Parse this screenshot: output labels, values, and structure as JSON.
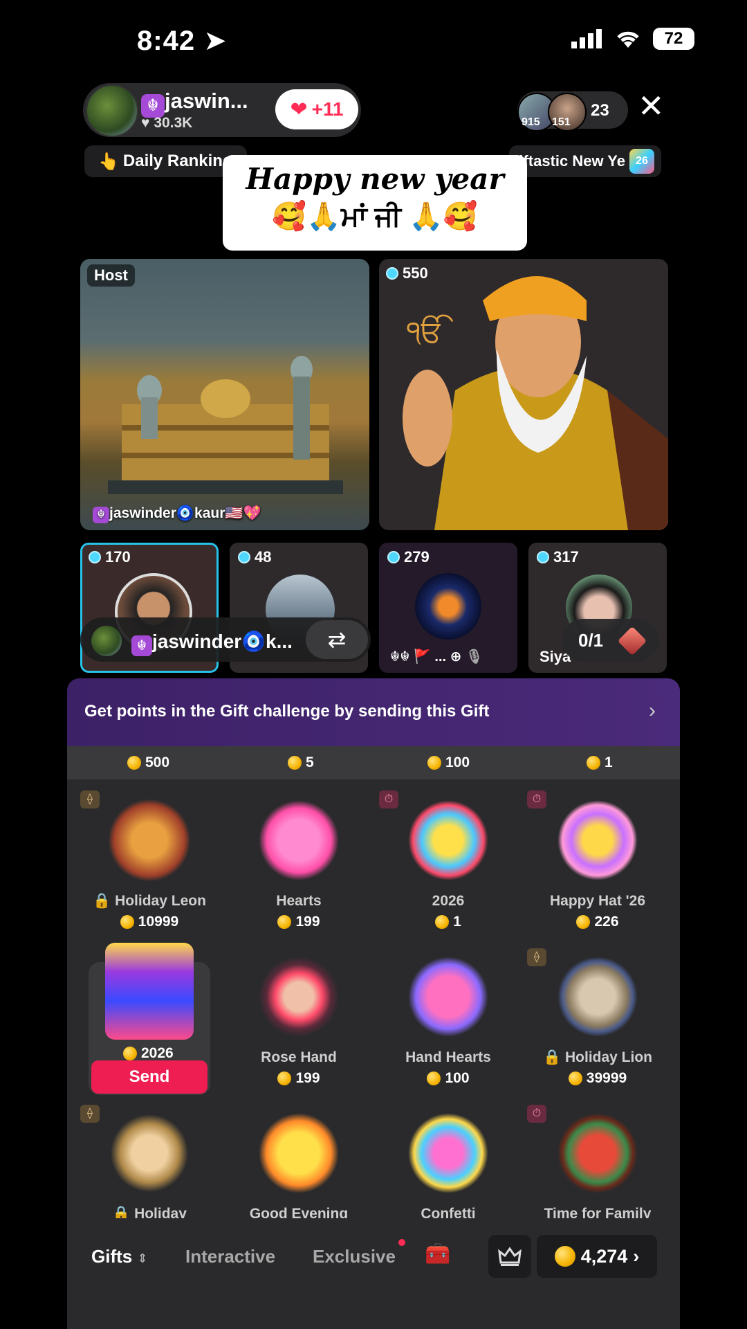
{
  "status": {
    "time": "8:42",
    "battery": "72"
  },
  "host": {
    "name": "jaswin...",
    "likes": "30.3K",
    "like_button": "+11"
  },
  "viewers": {
    "avatar1_badge": "915",
    "avatar2_badge": "151",
    "count": "23"
  },
  "ranking": {
    "label": "Daily Ranking"
  },
  "promo": {
    "label": "iftastic New Ye",
    "badge": "26"
  },
  "sticker": {
    "line1": "Happy new year",
    "line2": "🥰🙏ਮਾਂ ਜੀ 🙏🥰"
  },
  "host_tile": {
    "label": "Host",
    "caption": "jaswinder🧿kaur🇺🇸💖"
  },
  "guru_tile": {
    "points": "550"
  },
  "guest_tiles": [
    {
      "points": "170"
    },
    {
      "points": "48"
    },
    {
      "points": "279"
    },
    {
      "points": "317",
      "name_fragment": "Siya"
    }
  ],
  "name_pill": {
    "text": "jaswinder🧿k..."
  },
  "counter": {
    "text": "0/1"
  },
  "challenge": {
    "text": "Get points in the Gift challenge by sending this Gift"
  },
  "strip_prices": [
    "500",
    "5",
    "100",
    "1"
  ],
  "gifts_row1": [
    {
      "name": "Holiday Leon",
      "price": "10999",
      "locked": true
    },
    {
      "name": "Hearts",
      "price": "199"
    },
    {
      "name": "2026",
      "price": "1"
    },
    {
      "name": "Happy Hat '26",
      "price": "226"
    }
  ],
  "gifts_row2": [
    {
      "name": "2026",
      "price": "2026",
      "send": "Send"
    },
    {
      "name": "Rose Hand",
      "price": "199"
    },
    {
      "name": "Hand Hearts",
      "price": "100"
    },
    {
      "name": "Holiday Lion",
      "price": "39999",
      "locked": true
    }
  ],
  "gifts_row3": [
    {
      "name": "Holiday Universe",
      "locked": true
    },
    {
      "name": "Good Evening"
    },
    {
      "name": "Confetti"
    },
    {
      "name": "Time for Family"
    }
  ],
  "tabs": {
    "gifts": "Gifts",
    "interactive": "Interactive",
    "exclusive": "Exclusive"
  },
  "balance": "4,274",
  "colors": {
    "send": "#ee1d52",
    "challenge": "#4a2a7a",
    "coin": "#f5b300",
    "gem": "#4fd8ff"
  }
}
